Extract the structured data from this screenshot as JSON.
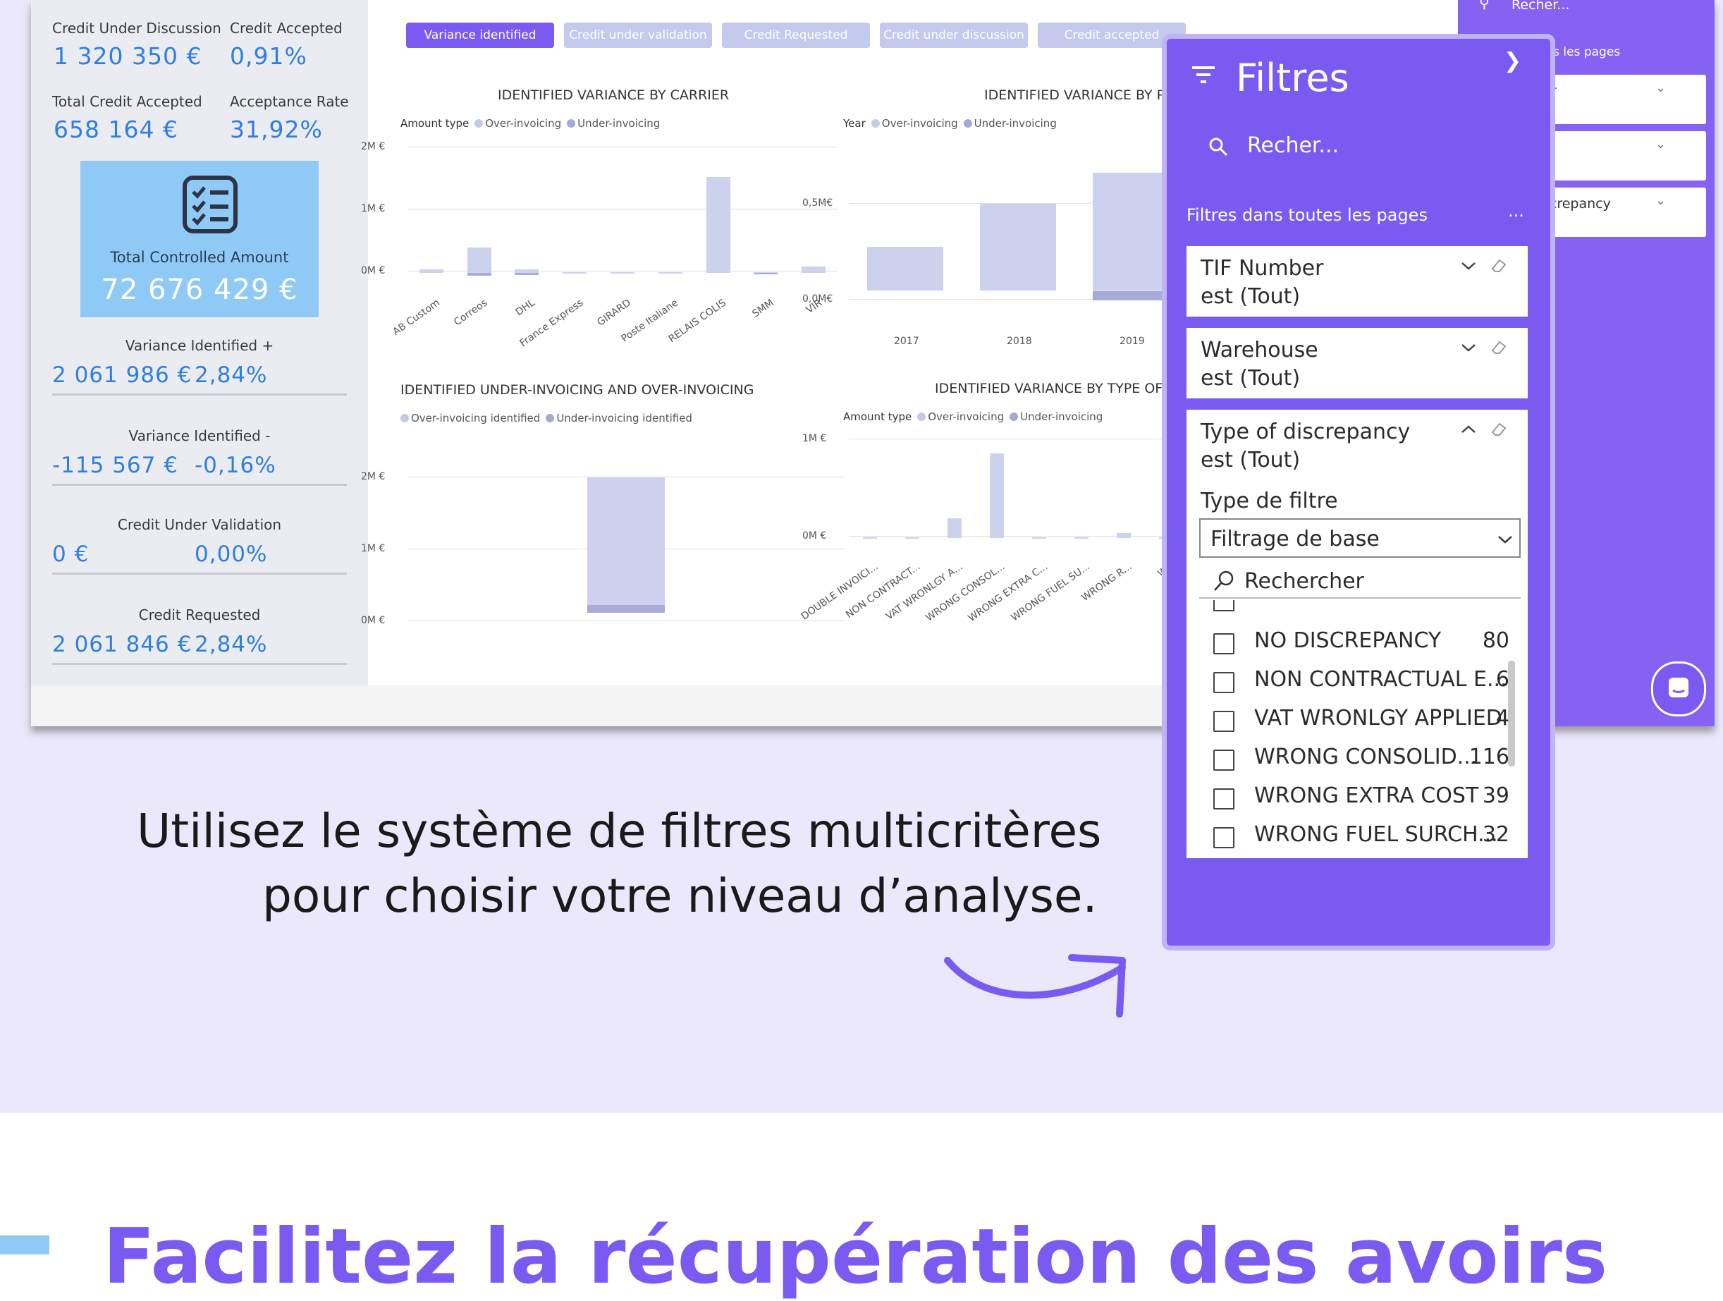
{
  "kpis": {
    "credit_under_discussion": {
      "label": "Credit Under Discussion",
      "value": "1 320 350 €"
    },
    "credit_accepted": {
      "label": "Credit Accepted",
      "value": "0,91%"
    },
    "total_credit_accepted": {
      "label": "Total Credit Accepted",
      "value": "658 164 €"
    },
    "acceptance_rate": {
      "label": "Acceptance Rate",
      "value": "31,92%"
    },
    "total_controlled": {
      "label": "Total Controlled Amount",
      "value": "72 676 429 €"
    },
    "variance_plus": {
      "label": "Variance Identified +",
      "amount": "2 061 986 €",
      "pct": "2,84%"
    },
    "variance_minus": {
      "label": "Variance Identified -",
      "amount": "-115 567 €",
      "pct": "-0,16%"
    },
    "credit_validation": {
      "label": "Credit Under Validation",
      "amount": "0 €",
      "pct": "0,00%"
    },
    "credit_requested": {
      "label": "Credit Requested",
      "amount": "2 061 846 €",
      "pct": "2,84%"
    }
  },
  "tabs": [
    "Variance identified",
    "Credit under validation",
    "Credit Requested",
    "Credit under discussion",
    "Credit accepted"
  ],
  "colors": {
    "accent": "#7b5af1",
    "kpi_blue": "#2f7fe0",
    "tile_blue": "#8fcaf6",
    "bar_light": "#ccd2ee",
    "bar_dark": "#a6acd6"
  },
  "chart_data": [
    {
      "type": "bar",
      "title": "IDENTIFIED VARIANCE BY CARRIER",
      "legend_title": "Amount type",
      "series_names": [
        "Over-invoicing",
        "Under-invoicing"
      ],
      "categories": [
        "AB Custom",
        "Correos",
        "DHL",
        "France Express",
        "GIRARD",
        "Poste Italiane",
        "RELAIS COLIS",
        "SMM",
        "VIR"
      ],
      "series": [
        {
          "name": "Over-invoicing",
          "values": [
            0.05,
            0.4,
            0.05,
            0.01,
            0.01,
            0.01,
            1.5,
            0.01,
            0.1
          ]
        },
        {
          "name": "Under-invoicing",
          "values": [
            0,
            -0.05,
            -0.03,
            0,
            0,
            0,
            0,
            -0.01,
            0
          ]
        }
      ],
      "y_ticks": [
        "2M €",
        "1M €",
        "0M €"
      ],
      "ylim": [
        -0.1,
        2
      ]
    },
    {
      "type": "bar",
      "title": "IDENTIFIED VARIANCE BY P",
      "legend_title": "Year",
      "series_names": [
        "Over-invoicing",
        "Under-invoicing"
      ],
      "categories": [
        "2017",
        "2018",
        "2019"
      ],
      "series": [
        {
          "name": "Over-invoicing",
          "values": [
            0.25,
            0.5,
            0.68
          ]
        },
        {
          "name": "Under-invoicing",
          "values": [
            0,
            0,
            -0.06
          ]
        }
      ],
      "y_ticks": [
        "0,5M€",
        "0,0M€"
      ],
      "ylim": [
        -0.1,
        0.7
      ]
    },
    {
      "type": "bar",
      "title": "IDENTIFIED UNDER-INVOICING AND OVER-INVOICING",
      "series_names": [
        "Over-invoicing identified",
        "Under-invoicing identified"
      ],
      "categories": [
        ""
      ],
      "series": [
        {
          "name": "Over-invoicing identified",
          "values": [
            2.06
          ]
        },
        {
          "name": "Under-invoicing identified",
          "values": [
            -0.12
          ]
        }
      ],
      "y_ticks": [
        "2M €",
        "1M €",
        "0M €"
      ],
      "ylim": [
        -0.2,
        2.3
      ]
    },
    {
      "type": "bar",
      "title": "IDENTIFIED VARIANCE BY TYPE OF D",
      "legend_title": "Amount type",
      "series_names": [
        "Over-invoicing",
        "Under-invoicing"
      ],
      "categories": [
        "DOUBLE INVOICI...",
        "NON CONTRACT...",
        "VAT WRONLGY A...",
        "WRONG CONSOL...",
        "WRONG EXTRA C...",
        "WRONG FUEL SU...",
        "WRONG R...",
        "WR"
      ],
      "series": [
        {
          "name": "Over-invoicing",
          "values": [
            0.01,
            0.01,
            0.2,
            0.85,
            0.01,
            0.01,
            0.05,
            0.01
          ]
        },
        {
          "name": "Under-invoicing",
          "values": [
            0,
            0,
            0,
            0,
            0,
            0,
            0,
            0
          ]
        }
      ],
      "y_ticks": [
        "1M €",
        "0M €"
      ],
      "ylim": [
        -0.05,
        1
      ]
    }
  ],
  "rpanel": {
    "search": "Recher...",
    "section": "tes les pages",
    "cards": [
      "er",
      "e",
      "screpancy"
    ]
  },
  "filters": {
    "title": "Filtres",
    "search_placeholder": "Recher...",
    "section": "Filtres dans toutes les pages",
    "more": "...",
    "cards": [
      {
        "name": "TIF Number",
        "state": "est (Tout)"
      },
      {
        "name": "Warehouse",
        "state": "est (Tout)"
      },
      {
        "name": "Type of discrepancy",
        "state": "est (Tout)"
      }
    ],
    "filter_type_label": "Type de filtre",
    "filter_type_value": "Filtrage de base",
    "list_search": "Rechercher",
    "items": [
      {
        "label": "NO DISCREPANCY",
        "count": "80"
      },
      {
        "label": "NON CONTRACTUAL E...",
        "count": "6"
      },
      {
        "label": "VAT WRONLGY APPLIED",
        "count": "4"
      },
      {
        "label": "WRONG CONSOLID...",
        "count": "116"
      },
      {
        "label": "WRONG EXTRA COST",
        "count": "39"
      },
      {
        "label": "WRONG FUEL SURCH...",
        "count": "32"
      }
    ]
  },
  "caption": {
    "line1": "Utilisez le système de filtres multicritères",
    "line2": "pour choisir votre niveau d’analyse."
  },
  "headline": "Facilitez la récupération des avoirs"
}
